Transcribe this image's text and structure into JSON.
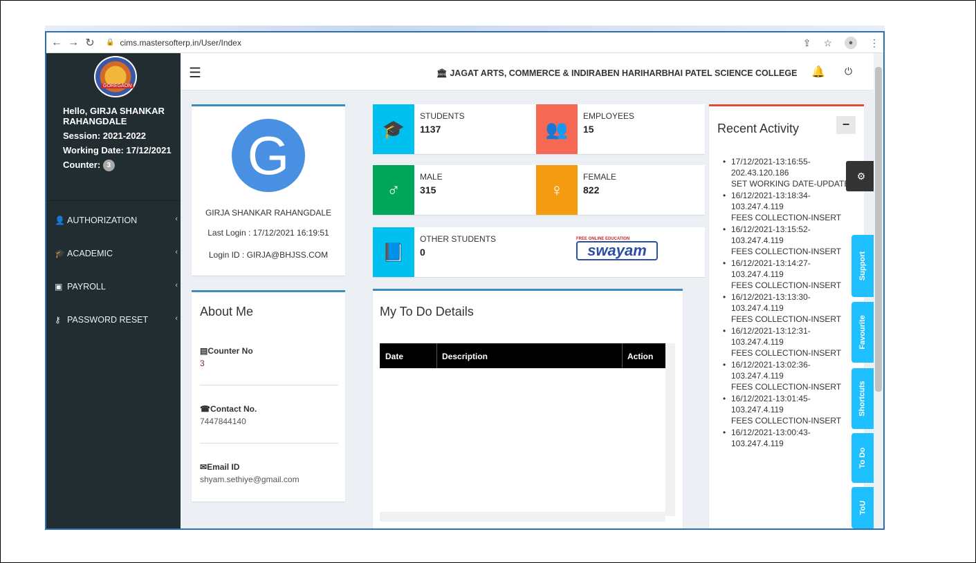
{
  "browser": {
    "url": "cims.mastersofterp.in/User/Index"
  },
  "sidebar": {
    "greeting": "Hello, GIRJA SHANKAR RAHANGDALE",
    "session": "Session: 2021-2022",
    "working_date": "Working Date: 17/12/2021",
    "counter_label": "Counter:",
    "counter_value": "3",
    "logo_text": "GOREGAON",
    "menu": [
      {
        "label": "AUTHORIZATION",
        "icon": "user-plus-icon"
      },
      {
        "label": "ACADEMIC",
        "icon": "graduation-cap-icon"
      },
      {
        "label": "PAYROLL",
        "icon": "money-icon"
      },
      {
        "label": "PASSWORD RESET",
        "icon": "key-icon"
      }
    ]
  },
  "header": {
    "college": "JAGAT ARTS, COMMERCE & INDIRABEN HARIHARBHAI PATEL SCIENCE COLLEGE"
  },
  "profile": {
    "initial": "G",
    "name": "GIRJA SHANKAR RAHANGDALE",
    "last_login": "Last Login : 17/12/2021 16:19:51",
    "login_id": "Login ID : GIRJA@BHJSS.COM"
  },
  "about": {
    "title": "About Me",
    "counter_label": "Counter No",
    "counter_value": "3",
    "contact_label": "Contact No.",
    "contact_value": "7447844140",
    "email_label": "Email ID",
    "email_value": "shyam.sethiye@gmail.com"
  },
  "stats": [
    {
      "label": "STUDENTS",
      "value": "1137",
      "color": "#00c0ef"
    },
    {
      "label": "EMPLOYEES",
      "value": "15",
      "color": "#f56954"
    },
    {
      "label": "MALE",
      "value": "315",
      "color": "#00a65a"
    },
    {
      "label": "FEMALE",
      "value": "822",
      "color": "#f39c12"
    },
    {
      "label": "OTHER STUDENTS",
      "value": "0",
      "color": "#00c0ef"
    }
  ],
  "swayam": {
    "tagline": "FREE ONLINE EDUCATION",
    "name": "swayam"
  },
  "todo": {
    "title": "My To Do Details",
    "col_date": "Date",
    "col_desc": "Description",
    "col_action": "Action"
  },
  "recent": {
    "title": "Recent Activity",
    "items": [
      [
        "17/12/2021-13:16:55-",
        "202.43.120.186",
        "SET WORKING DATE-UPDATE"
      ],
      [
        "16/12/2021-13:18:34-",
        "103.247.4.119",
        "FEES COLLECTION-INSERT"
      ],
      [
        "16/12/2021-13:15:52-",
        "103.247.4.119",
        "FEES COLLECTION-INSERT"
      ],
      [
        "16/12/2021-13:14:27-",
        "103.247.4.119",
        "FEES COLLECTION-INSERT"
      ],
      [
        "16/12/2021-13:13:30-",
        "103.247.4.119",
        "FEES COLLECTION-INSERT"
      ],
      [
        "16/12/2021-13:12:31-",
        "103.247.4.119",
        "FEES COLLECTION-INSERT"
      ],
      [
        "16/12/2021-13:02:36-",
        "103.247.4.119",
        "FEES COLLECTION-INSERT"
      ],
      [
        "16/12/2021-13:01:45-",
        "103.247.4.119",
        "FEES COLLECTION-INSERT"
      ],
      [
        "16/12/2021-13:00:43-",
        "103.247.4.119",
        ""
      ]
    ]
  },
  "sidetabs": [
    "Support",
    "Favourite",
    "Shortcuts",
    "To Do",
    "ToU"
  ]
}
